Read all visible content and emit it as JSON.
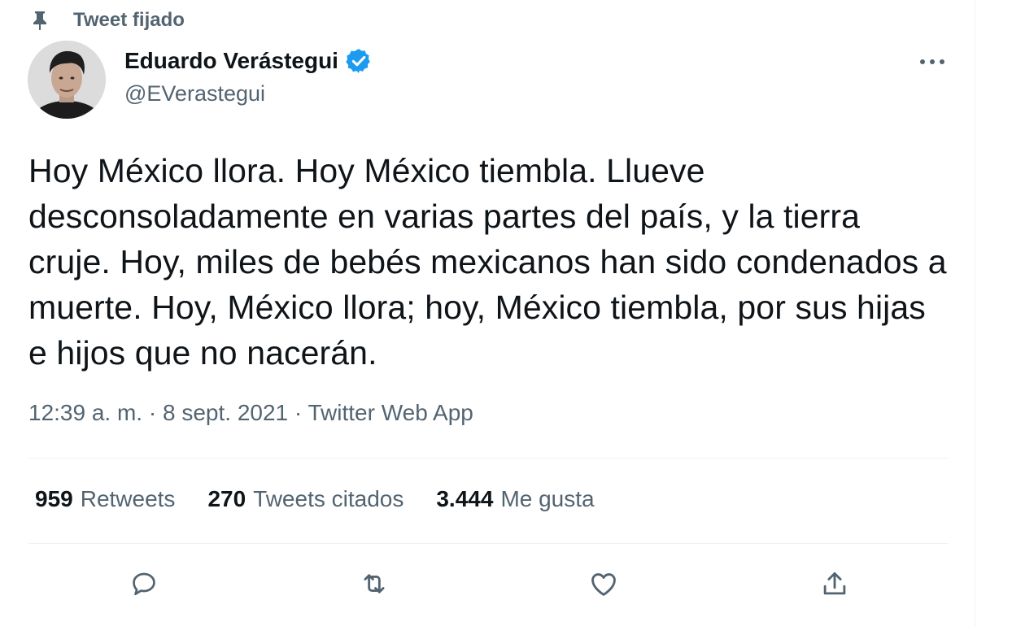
{
  "pinned": {
    "label": "Tweet fijado",
    "icon": "pin-icon"
  },
  "author": {
    "name": "Eduardo Verástegui",
    "handle": "@EVerastegui",
    "verified_icon": "verified-badge-icon",
    "verified_color": "#1d9bf0"
  },
  "tweet": {
    "text": "Hoy México llora. Hoy México tiembla. Llueve desconsoladamente en varias partes del país, y la tierra cruje. Hoy, miles de bebés mexicanos han sido condenados a muerte. Hoy, México llora; hoy, México tiembla, por sus hijas e hijos que no nacerán.",
    "time": "12:39 a. m.",
    "separator": " · ",
    "date": "8 sept. 2021",
    "source": "Twitter Web App"
  },
  "stats": {
    "retweets_count": "959",
    "retweets_label": "Retweets",
    "quotes_count": "270",
    "quotes_label": "Tweets citados",
    "likes_count": "3.444",
    "likes_label": "Me gusta"
  },
  "actions": [
    "reply-icon",
    "retweet-icon",
    "like-icon",
    "share-icon"
  ],
  "colors": {
    "text": "#0f1419",
    "secondary": "#536471",
    "divider": "#eff3f4",
    "accent": "#1d9bf0"
  }
}
